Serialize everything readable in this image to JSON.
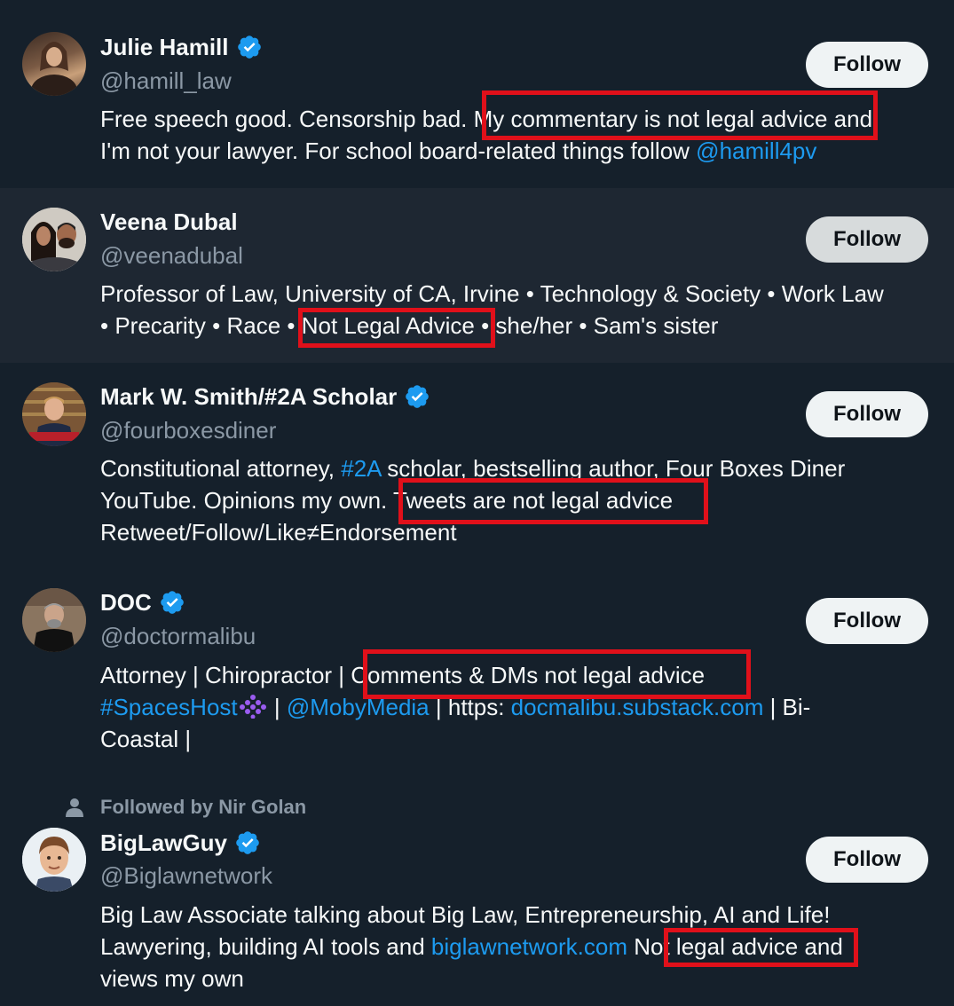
{
  "colors": {
    "background": "#15202b",
    "hover_row": "#1e2732",
    "secondary_text": "#8b98a5",
    "link": "#1d9bf0",
    "verified": "#1d9bf0",
    "highlight_box": "#e0101a",
    "follow_button_bg": "#eff3f4"
  },
  "users": [
    {
      "name": "Julie Hamill",
      "handle": "@hamill_law",
      "verified": true,
      "follow_label": "Follow",
      "bio_lines": [
        [
          "Free speech good. Censorship bad. ",
          "My commentary is not legal advice",
          " and"
        ],
        [
          "I'm not your lawyer. For school board-related things follow ",
          "@hamill4pv"
        ]
      ]
    },
    {
      "name": "Veena Dubal",
      "handle": "@veenadubal",
      "verified": false,
      "follow_label": "Follow",
      "bio_lines": [
        [
          "Professor of Law, University of CA, Irvine • Technology & Society • Work Law"
        ],
        [
          "• Precarity • Race • ",
          "Not Legal Advice",
          " • she/her • Sam's sister"
        ]
      ]
    },
    {
      "name": "Mark W. Smith/#2A Scholar",
      "handle": "@fourboxesdiner",
      "verified": true,
      "follow_label": "Follow",
      "bio_lines": [
        [
          "Constitutional attorney, ",
          "#2A",
          " scholar, bestselling author, Four Boxes Diner"
        ],
        [
          "YouTube. Opinions my own. ",
          "Tweets are not legal advice"
        ],
        [
          "Retweet/Follow/Like≠Endorsement"
        ]
      ]
    },
    {
      "name": "DOC",
      "handle": "@doctormalibu",
      "verified": true,
      "follow_label": "Follow",
      "bio_lines": [
        [
          "Attorney | Chiropractor | ",
          "Comments & DMs not legal advice"
        ],
        [
          "#SpacesHost",
          " | ",
          "@MobyMedia",
          " | https: ",
          "docmalibu.substack.com",
          " | Bi-"
        ],
        [
          "Coastal |"
        ]
      ]
    },
    {
      "social_context": "Followed by Nir Golan",
      "name": "BigLawGuy",
      "handle": "@Biglawnetwork",
      "verified": true,
      "follow_label": "Follow",
      "bio_lines": [
        [
          "Big Law Associate talking about Big Law, Entrepreneurship, AI and Life!"
        ],
        [
          "Lawyering, building AI tools and ",
          "biglawnetwork.com",
          " ",
          "Not legal advice",
          " and"
        ],
        [
          "views my own"
        ]
      ]
    }
  ]
}
